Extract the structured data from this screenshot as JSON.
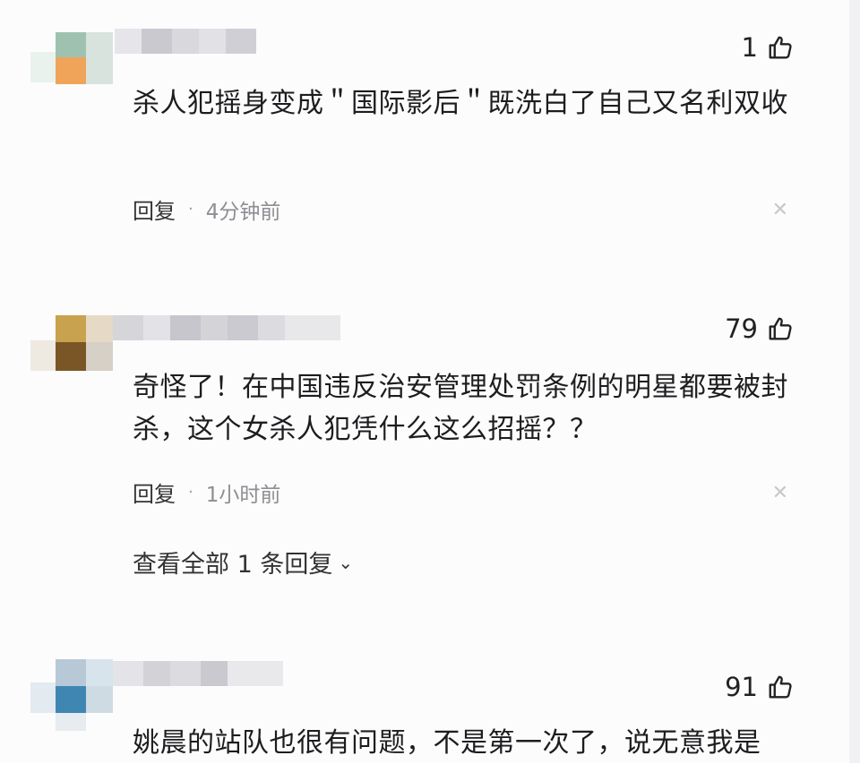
{
  "comments": [
    {
      "likes": "1",
      "text": "杀人犯摇身变成＂国际影后＂既洗白了自己又名利双收",
      "reply_label": "回复",
      "time": "4分钟前"
    },
    {
      "likes": "79",
      "text": "奇怪了！在中国违反治安管理处罚条例的明星都要被封杀，这个女杀人犯凭什么这么招摇？？",
      "reply_label": "回复",
      "time": "1小时前",
      "view_replies": "查看全部 1 条回复"
    },
    {
      "likes": "91",
      "text": "姚晨的站队也很有问题，不是第一次了，说无意我是"
    }
  ],
  "icons": {
    "like": "thumbs-up-icon",
    "close": "close-icon",
    "expand": "chevron-down-icon"
  },
  "colors": {
    "text": "#1d1d1f",
    "meta": "#8e8e93",
    "background": "#fcfcfd"
  }
}
